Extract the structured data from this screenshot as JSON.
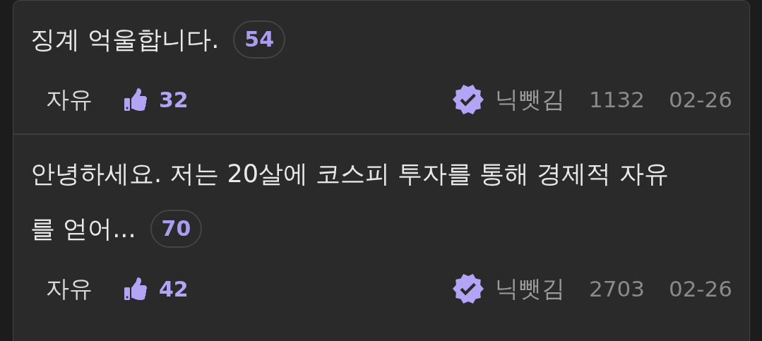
{
  "posts": [
    {
      "title_lines": [
        "징계 억울합니다."
      ],
      "comment_count": "54",
      "category": "자유",
      "likes": "32",
      "verified": true,
      "author": "닉뺏김",
      "views": "1132",
      "date": "02-26"
    },
    {
      "title_lines": [
        "안녕하세요. 저는 20살에 코스피 투자를 통해 경제적 자유",
        "를 얻어..."
      ],
      "comment_count": "70",
      "category": "자유",
      "likes": "42",
      "verified": true,
      "author": "닉뺏김",
      "views": "2703",
      "date": "02-26"
    }
  ]
}
